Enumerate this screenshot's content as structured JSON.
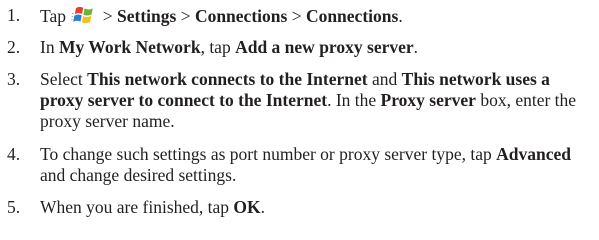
{
  "steps": [
    {
      "number": "1.",
      "tap": "Tap",
      "start_icon": "windows-start-flag-icon",
      "sep0": " > ",
      "path1": "Settings",
      "sep1": " > ",
      "path2": "Connections",
      "sep2": " > ",
      "path3": "Connections",
      "end": "."
    },
    {
      "number": "2.",
      "t1": "In ",
      "b1": "My Work Network",
      "t2": ", tap ",
      "b2": "Add a new proxy server",
      "t3": "."
    },
    {
      "number": "3.",
      "t1": "Select ",
      "b1": "This network connects to the Internet",
      "t2": " and ",
      "b2": "This network uses a proxy server to connect to the Internet",
      "t3": ". In the ",
      "b3": "Proxy server",
      "t4": " box, enter the proxy server name."
    },
    {
      "number": "4.",
      "t1": "To change such settings as port number or proxy server type, tap ",
      "b1": "Advanced",
      "t2": " and change desired settings."
    },
    {
      "number": "5.",
      "t1": "When you are finished, tap ",
      "b1": "OK",
      "t2": "."
    }
  ]
}
